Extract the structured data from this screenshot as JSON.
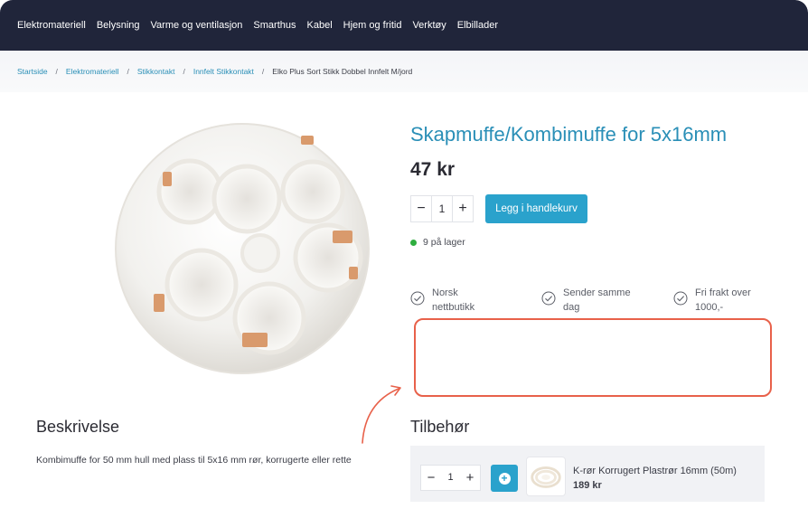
{
  "nav": {
    "items": [
      "Elektromateriell",
      "Belysning",
      "Varme og ventilasjon",
      "Smarthus",
      "Kabel",
      "Hjem og fritid",
      "Verktøy",
      "Elbillader"
    ]
  },
  "breadcrumb": {
    "links": [
      "Startside",
      "Elektromateriell",
      "Stikkontakt",
      "Innfelt Stikkontakt"
    ],
    "current": "Elko Plus Sort Stikk Dobbel Innfelt M/jord",
    "separator": "/"
  },
  "product": {
    "title": "Skapmuffe/Kombimuffe for 5x16mm",
    "price": "47 kr",
    "quantity": "1",
    "add_to_cart": "Legg i handlekurv",
    "stock": "9 på lager",
    "stock_color": "#2fae3f"
  },
  "usps": [
    {
      "line1": "Norsk",
      "line2": "nettbutikk"
    },
    {
      "line1": "Sender samme",
      "line2": "dag"
    },
    {
      "line1": "Fri frakt over",
      "line2": "1000,-"
    }
  ],
  "description": {
    "heading": "Beskrivelse",
    "text": "Kombimuffe for 50 mm hull med plass til 5x16 mm rør, korrugerte eller rette"
  },
  "accessories": {
    "heading": "Tilbehør",
    "items": [
      {
        "quantity": "1",
        "name": "K-rør Korrugert Plastrør 16mm (50m)",
        "price": "189 kr"
      }
    ]
  },
  "colors": {
    "nav_bg": "#20253a",
    "accent": "#2aa2cc",
    "link": "#2a8fb7",
    "highlight": "#e8614a"
  }
}
